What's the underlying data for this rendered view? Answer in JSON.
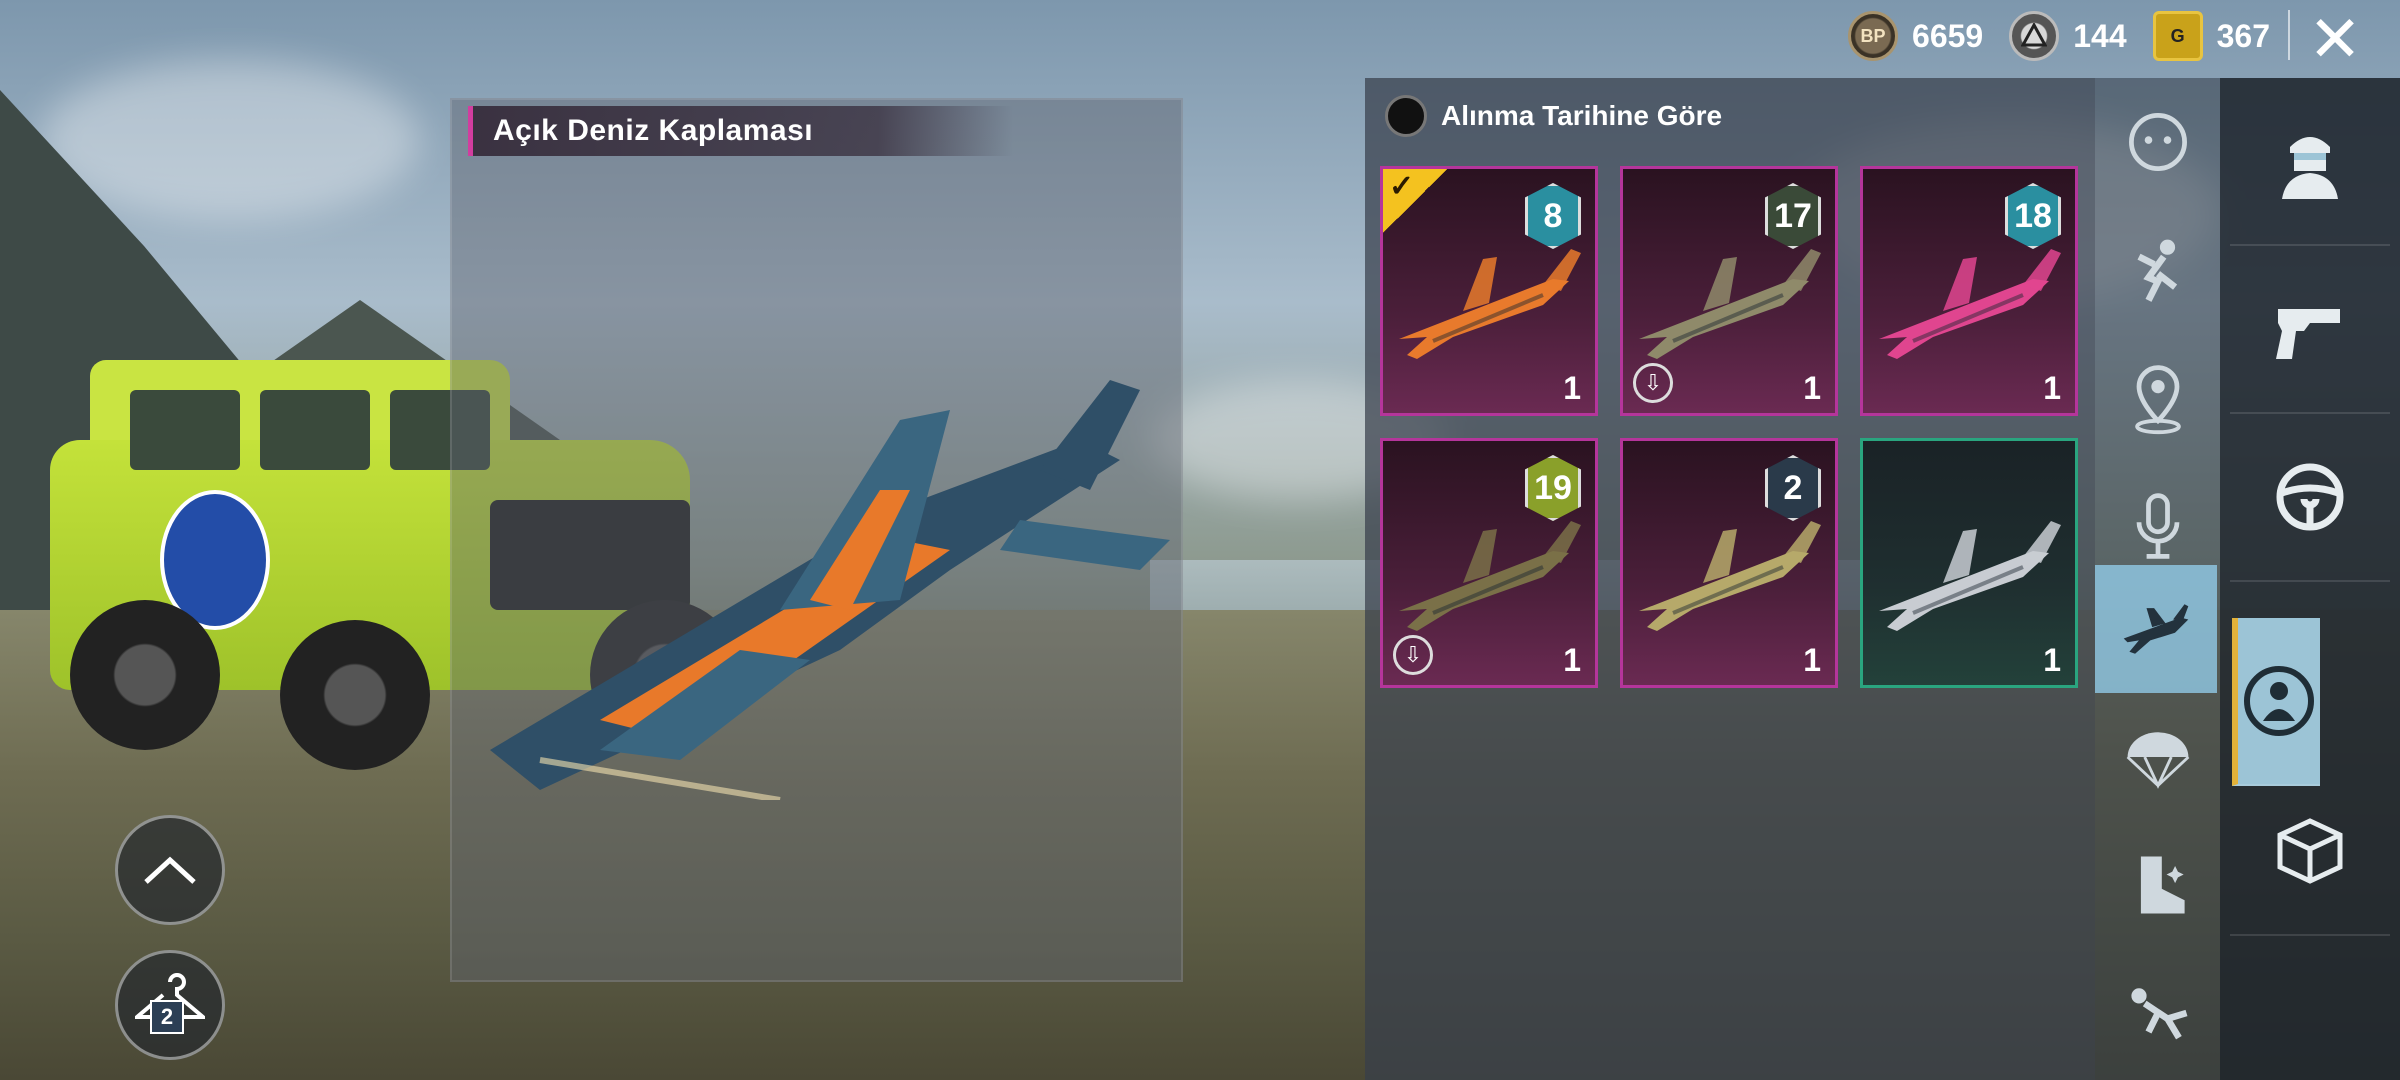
{
  "currencies": [
    {
      "icon": "bp-coin-icon",
      "symbol": "BP",
      "amount": "6659"
    },
    {
      "icon": "ag-coin-icon",
      "symbol": "",
      "amount": "144"
    },
    {
      "icon": "uc-coin-icon",
      "symbol": "G",
      "amount": "367"
    }
  ],
  "close_label": "✕",
  "detail": {
    "title": "Açık Deniz Kaplaması"
  },
  "left_controls": {
    "wardrobe_count": "2"
  },
  "inventory": {
    "sort_label": "Alınma Tarihine Göre",
    "items": [
      {
        "level": "8",
        "quantity": "1",
        "equipped": true,
        "downloadable": false,
        "rarity": "legendary",
        "badge_color": "#2a8fa0",
        "plane_color": "#e87a2c"
      },
      {
        "level": "17",
        "quantity": "1",
        "equipped": false,
        "downloadable": true,
        "rarity": "legendary",
        "badge_color": "#3a4a38",
        "plane_color": "#8f8a6a"
      },
      {
        "level": "18",
        "quantity": "1",
        "equipped": false,
        "downloadable": false,
        "rarity": "legendary",
        "badge_color": "#2a8fa0",
        "plane_color": "#e0458f"
      },
      {
        "level": "19",
        "quantity": "1",
        "equipped": false,
        "downloadable": true,
        "rarity": "legendary",
        "badge_color": "#8aa02a",
        "plane_color": "#7a7048"
      },
      {
        "level": "2",
        "quantity": "1",
        "equipped": false,
        "downloadable": false,
        "rarity": "legendary",
        "badge_color": "#2a3a4a",
        "plane_color": "#b6a96a"
      },
      {
        "level": "",
        "quantity": "1",
        "equipped": false,
        "downloadable": false,
        "rarity": "epic",
        "badge_color": "",
        "plane_color": "#c8ccd2"
      }
    ]
  },
  "categories": [
    {
      "icon": "emote-face-icon",
      "active": false
    },
    {
      "icon": "emote-pose-icon",
      "active": false
    },
    {
      "icon": "location-pin-icon",
      "active": false
    },
    {
      "icon": "microphone-icon",
      "active": false
    },
    {
      "icon": "airplane-icon",
      "active": true
    },
    {
      "icon": "parachute-icon",
      "active": false
    },
    {
      "icon": "boot-icon",
      "active": false
    },
    {
      "icon": "skydive-icon",
      "active": false
    }
  ],
  "tabs": [
    {
      "icon": "character-icon",
      "active": false
    },
    {
      "icon": "pistol-icon",
      "active": false
    },
    {
      "icon": "steering-wheel-icon",
      "active": false
    },
    {
      "icon": "player-avatar-icon",
      "active": true
    },
    {
      "icon": "crate-icon",
      "active": false
    }
  ]
}
